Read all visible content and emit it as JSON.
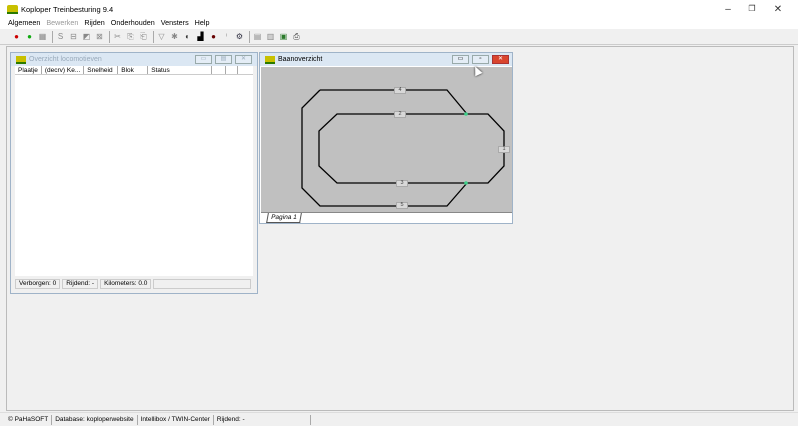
{
  "app": {
    "title": "Koploper Treinbesturing 9.4",
    "minimize": "–",
    "restore": "❐",
    "close": "✕"
  },
  "menu": [
    {
      "label": "Algemeen",
      "enabled": true
    },
    {
      "label": "Bewerken",
      "enabled": false
    },
    {
      "label": "Rijden",
      "enabled": true
    },
    {
      "label": "Onderhouden",
      "enabled": true
    },
    {
      "label": "Vensters",
      "enabled": true
    },
    {
      "label": "Help",
      "enabled": true
    }
  ],
  "toolbar": {
    "icons": [
      "signal-red-icon",
      "signal-green-icon",
      "keyboard-icon",
      "|",
      "s-icon",
      "block-icon",
      "edit-icon",
      "grid-icon",
      "|",
      "cut-icon",
      "copy-icon",
      "paste-icon",
      "|",
      "filter-icon",
      "gear-icon",
      "loco-icon",
      "train-icon",
      "bug-icon",
      "info-icon",
      "tools-icon",
      "|",
      "document-icon",
      "document2-icon",
      "export-icon",
      "print-icon"
    ],
    "glyphs": [
      "●",
      "●",
      "▦",
      "|",
      "S",
      "⊟",
      "◩",
      "⊠",
      "|",
      "✂",
      "⎘",
      "⎗",
      "|",
      "▽",
      "✱",
      "◐",
      "▟",
      "●",
      "ⁱ",
      "⚙",
      "|",
      "▤",
      "▥",
      "▣",
      "⎙"
    ]
  },
  "loco_window": {
    "title": "Overzicht locomotieven",
    "columns": [
      "Plaatje",
      "(decrv) Ke...",
      "Snelheid",
      "Blok",
      "Status",
      "",
      ""
    ],
    "status": [
      "Verborgen: 0",
      "Rijdend: -",
      "Kilometers: 0.0",
      ""
    ]
  },
  "baan_window": {
    "title": "Baanoverzicht",
    "tab": "Pagina 1",
    "blocks": [
      {
        "label": "4"
      },
      {
        "label": "2"
      },
      {
        "label": "1"
      },
      {
        "label": "3"
      },
      {
        "label": "5"
      }
    ],
    "track_color": "#000000",
    "switch_color": "#3fd08a"
  },
  "statusbar": [
    "© PaHaSOFT",
    "Database: koploperwebsite",
    "Intellibox / TWIN-Center",
    "Rijdend: -",
    "",
    ""
  ]
}
